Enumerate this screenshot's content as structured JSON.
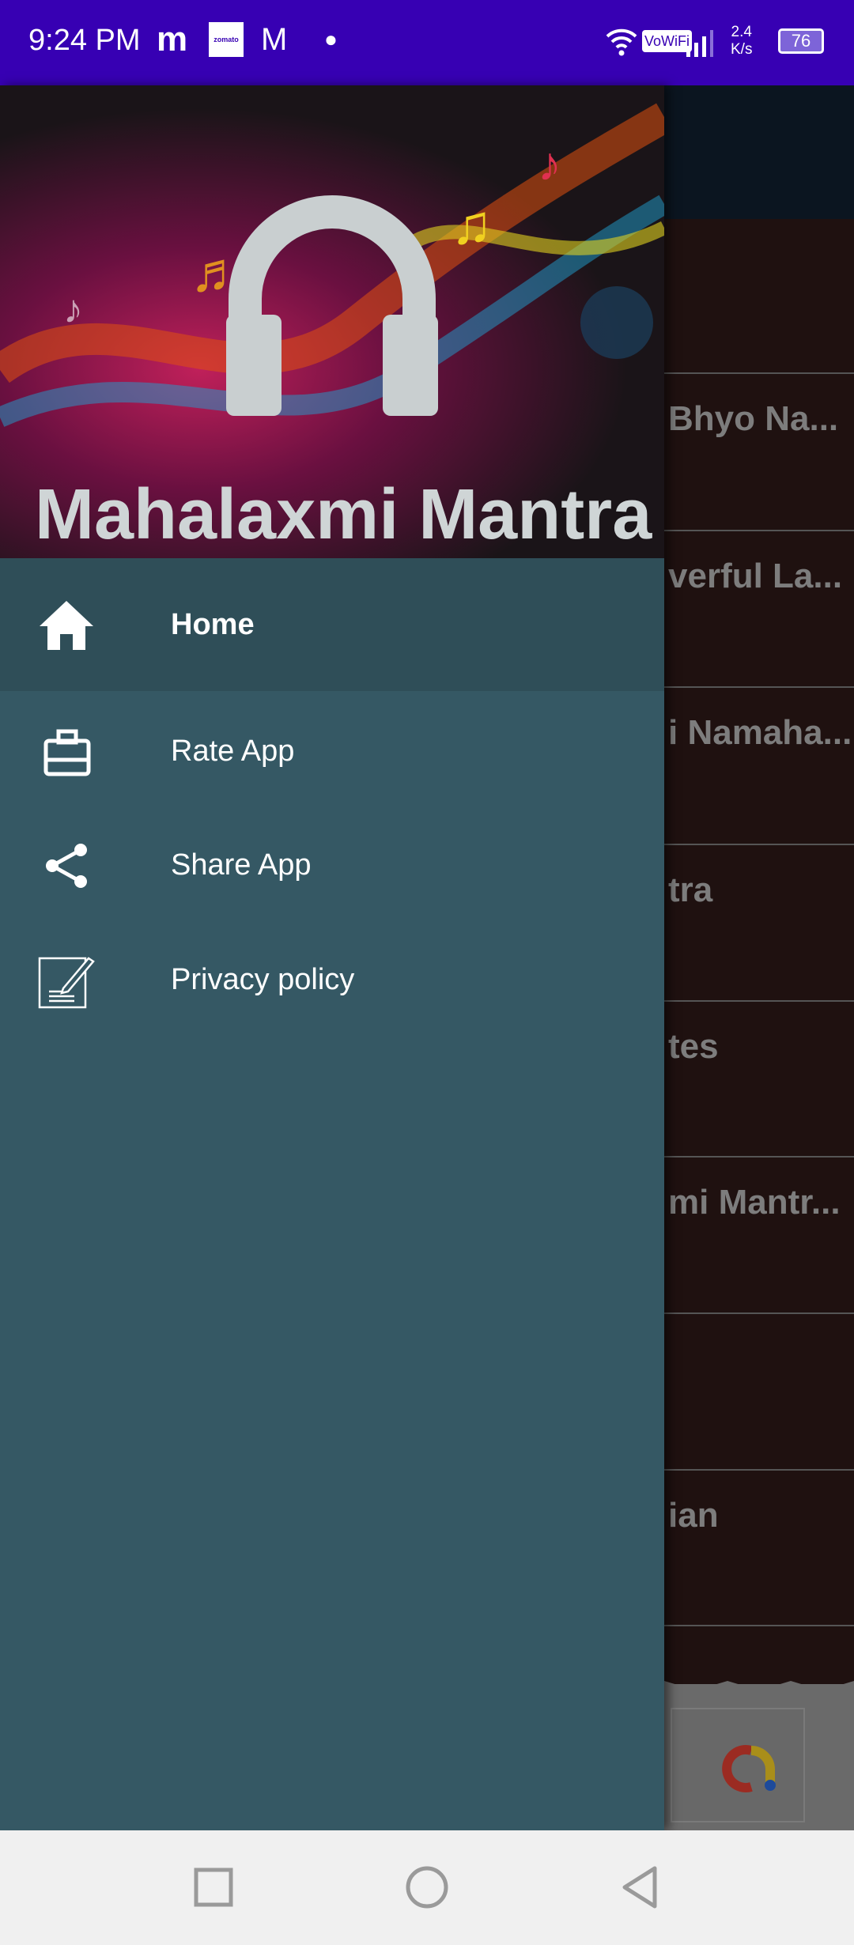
{
  "status_bar": {
    "time": "9:24 PM",
    "network_speed": "2.4",
    "network_unit": "K/s",
    "battery": "76",
    "vowifi": "VoWiFi",
    "zomato": "zomato",
    "color": "#3700b3"
  },
  "drawer": {
    "header_title": "Mahalaxmi Mantra",
    "items": [
      {
        "label": "Home",
        "icon": "home-icon",
        "active": true
      },
      {
        "label": "Rate App",
        "icon": "briefcase-icon"
      },
      {
        "label": "Share App",
        "icon": "share-icon"
      },
      {
        "label": "Privacy policy",
        "icon": "edit-document-icon"
      }
    ],
    "bg_color": "#355864"
  },
  "background_list": {
    "items": [
      "Bhyo Na...",
      "verful La...",
      "i Namaha...",
      "tra",
      "tes",
      "mi Mantr...",
      "",
      "ian"
    ]
  }
}
